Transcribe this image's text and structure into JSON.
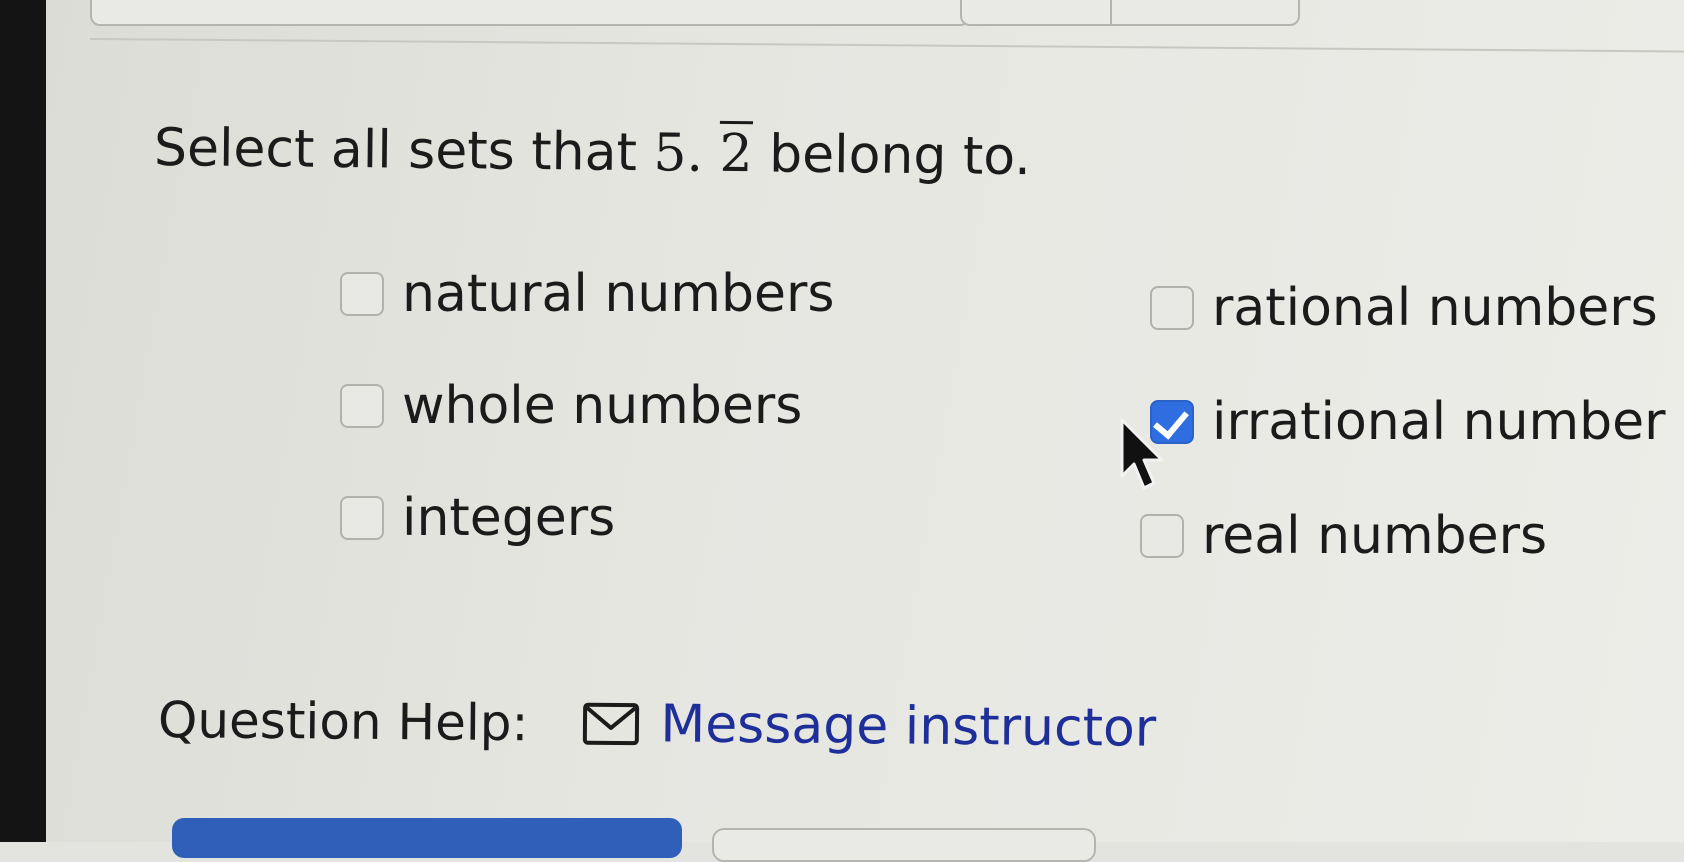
{
  "question": {
    "prefix": "Select all sets that ",
    "number_whole": "5.",
    "number_repeating": "2",
    "suffix": " belong to."
  },
  "options": [
    {
      "label": "natural numbers",
      "checked": false
    },
    {
      "label": "whole numbers",
      "checked": false
    },
    {
      "label": "integers",
      "checked": false
    },
    {
      "label": "rational numbers",
      "checked": false
    },
    {
      "label": "irrational number",
      "checked": true
    },
    {
      "label": "real numbers",
      "checked": false
    }
  ],
  "help": {
    "label": "Question Help:",
    "link_icon": "mail-icon",
    "link_text": "Message instructor"
  },
  "colors": {
    "checked_box": "#2f6ee0",
    "link": "#1f2f9a"
  }
}
